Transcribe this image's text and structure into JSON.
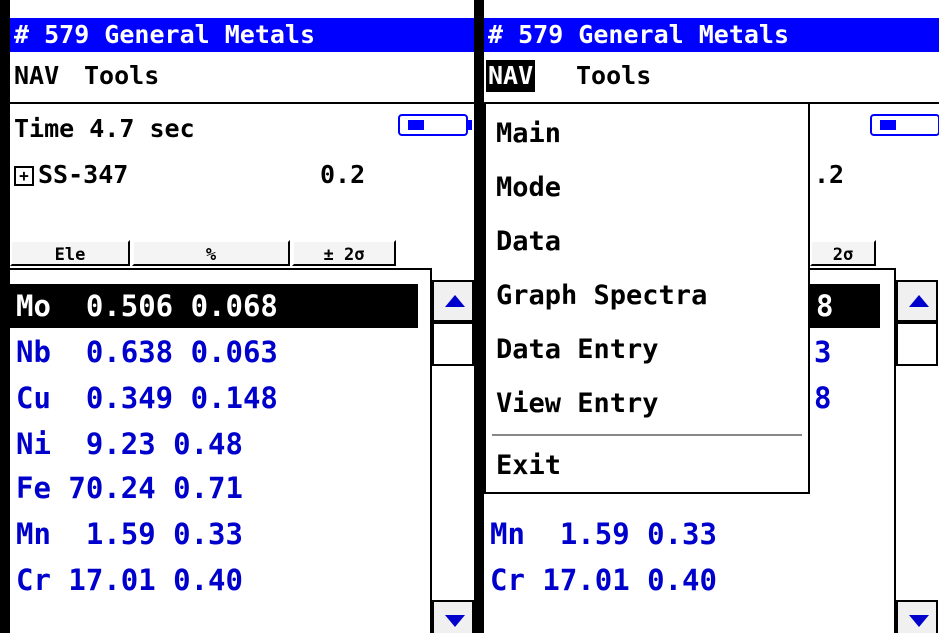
{
  "title": "# 579 General Metals",
  "menu": {
    "nav": "NAV",
    "tools": "Tools"
  },
  "status": {
    "time": "Time 4.7 sec",
    "plus": "+",
    "sample": "SS-347",
    "sample_value": "0.2"
  },
  "columns": {
    "element": "Ele",
    "percent": "%",
    "sigma": "± 2σ"
  },
  "rows": [
    {
      "element": "Mo",
      "percent": "0.506",
      "sigma": "0.068",
      "text": "Mo  0.506 0.068"
    },
    {
      "element": "Nb",
      "percent": "0.638",
      "sigma": "0.063",
      "text": "Nb  0.638 0.063"
    },
    {
      "element": "Cu",
      "percent": "0.349",
      "sigma": "0.148",
      "text": "Cu  0.349 0.148"
    },
    {
      "element": "Ni",
      "percent": "9.23",
      "sigma": "0.48",
      "text": "Ni  9.23 0.48"
    },
    {
      "element": "Fe",
      "percent": "70.24",
      "sigma": "0.71",
      "text": "Fe 70.24 0.71"
    },
    {
      "element": "Mn",
      "percent": "1.59",
      "sigma": "0.33",
      "text": "Mn  1.59 0.33"
    },
    {
      "element": "Cr",
      "percent": "17.01",
      "sigma": "0.40",
      "text": "Cr 17.01 0.40"
    }
  ],
  "right_partial": {
    "sample_value": ".2",
    "sigma_header": "2σ",
    "row0": "8",
    "row1": "3",
    "row2": "8"
  },
  "nav_dropdown": {
    "items": [
      "Main",
      "Mode",
      "Data",
      "Graph Spectra",
      "Data Entry",
      "View Entry"
    ],
    "exit": "Exit"
  },
  "icons": {
    "battery": "battery-icon",
    "expand": "plus-expand-icon",
    "scroll_up": "arrow-up-icon",
    "scroll_down": "arrow-down-icon"
  },
  "colors": {
    "title_bg": "#0000ff",
    "data_text": "#0000cc",
    "selected_bg": "#000000"
  }
}
